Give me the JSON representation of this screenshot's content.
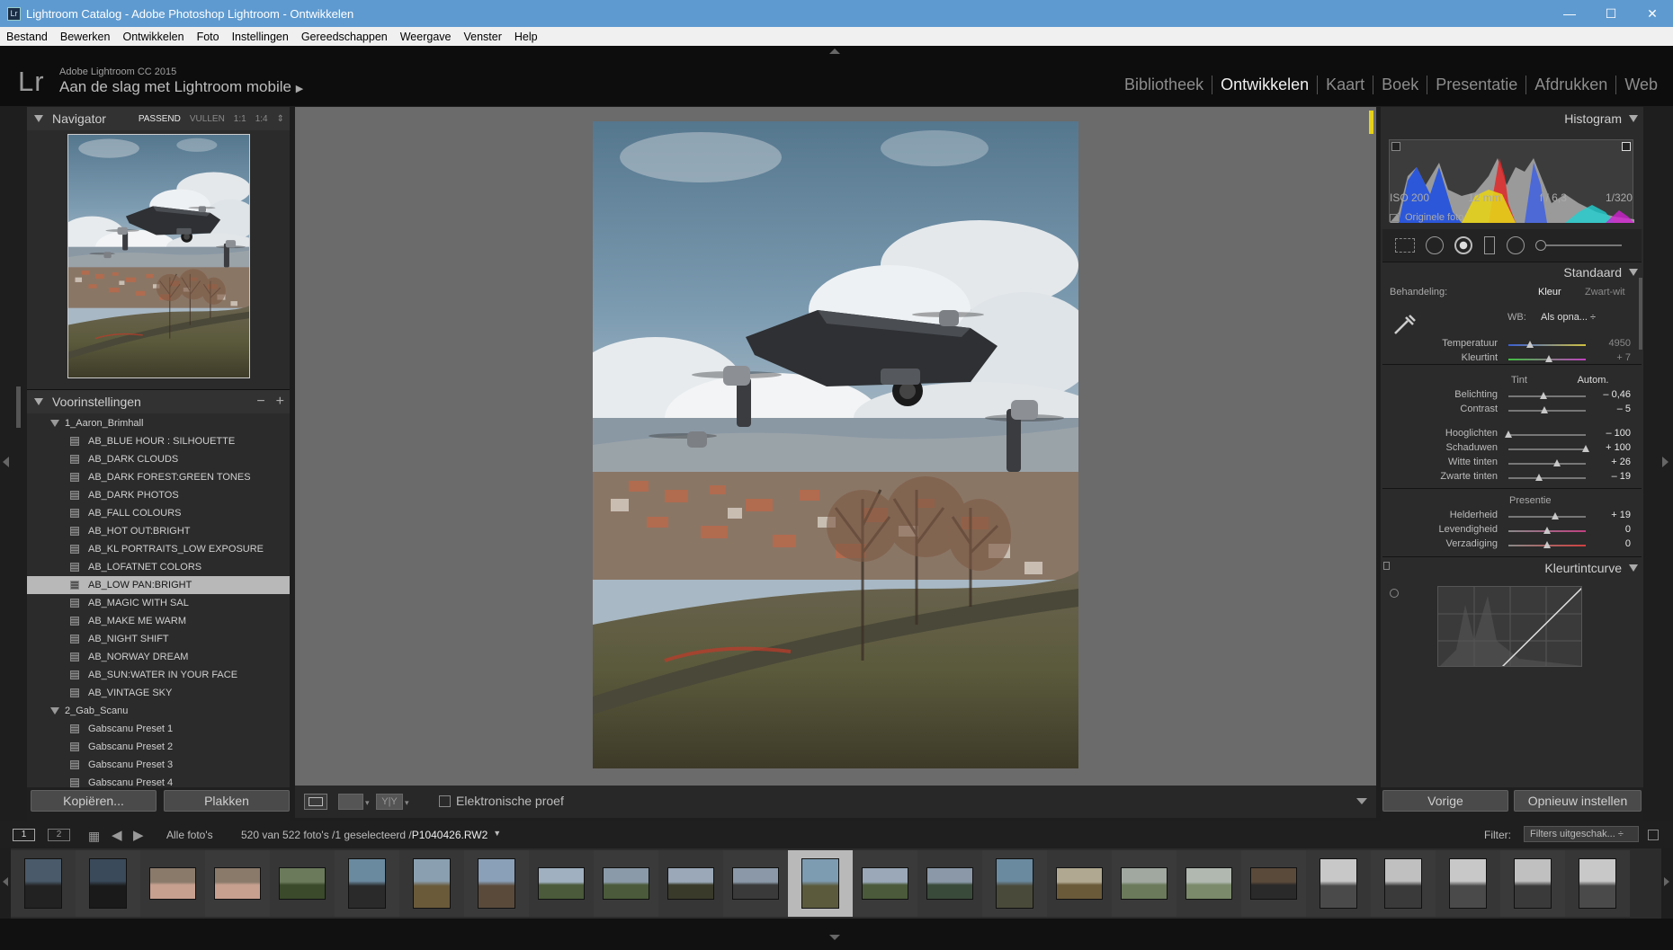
{
  "window": {
    "title": "Lightroom Catalog - Adobe Photoshop Lightroom - Ontwikkelen",
    "controls": {
      "minimize": "—",
      "maximize": "☐",
      "close": "✕"
    }
  },
  "menu": [
    "Bestand",
    "Bewerken",
    "Ontwikkelen",
    "Foto",
    "Instellingen",
    "Gereedschappen",
    "Weergave",
    "Venster",
    "Help"
  ],
  "identity": {
    "logo": "Lr",
    "app": "Adobe Lightroom CC 2015",
    "mobile": "Aan de slag met Lightroom mobile"
  },
  "modules": [
    "Bibliotheek",
    "Ontwikkelen",
    "Kaart",
    "Boek",
    "Presentatie",
    "Afdrukken",
    "Web"
  ],
  "navigator": {
    "title": "Navigator",
    "options": [
      "PASSEND",
      "VULLEN",
      "1:1",
      "1:4"
    ],
    "selected": "PASSEND"
  },
  "presets": {
    "title": "Voorinstellingen",
    "folders": [
      {
        "name": "1_Aaron_Brimhall",
        "items": [
          "AB_BLUE HOUR : SILHOUETTE",
          "AB_DARK CLOUDS",
          "AB_DARK FOREST:GREEN TONES",
          "AB_DARK PHOTOS",
          "AB_FALL COLOURS",
          "AB_HOT OUT:BRIGHT",
          "AB_KL PORTRAITS_LOW EXPOSURE",
          "AB_LOFATNET COLORS",
          "AB_LOW PAN:BRIGHT",
          "AB_MAGIC WITH SAL",
          "AB_MAKE ME WARM",
          "AB_NIGHT SHIFT",
          "AB_NORWAY DREAM",
          "AB_SUN:WATER IN YOUR FACE",
          "AB_VINTAGE SKY"
        ],
        "selected": "AB_LOW PAN:BRIGHT"
      },
      {
        "name": "2_Gab_Scanu",
        "items": [
          "Gabscanu Preset 1",
          "Gabscanu Preset 2",
          "Gabscanu Preset 3",
          "Gabscanu Preset 4"
        ]
      }
    ],
    "copy_button": "Kopiëren...",
    "paste_button": "Plakken"
  },
  "toolbar": {
    "proof_label": "Elektronische proef"
  },
  "histogram": {
    "title": "Histogram",
    "iso": "ISO 200",
    "focal": "12 mm",
    "aperture": "f / 6,3",
    "shutter": "1/320",
    "original_label": "Originele foto"
  },
  "basic": {
    "title": "Standaard",
    "treatment_label": "Behandeling:",
    "treatment_options": [
      "Kleur",
      "Zwart-wit"
    ],
    "wb_label": "WB:",
    "wb_value": "Als opna... ÷",
    "tone_label": "Tint",
    "auto_label": "Autom.",
    "presence_label": "Presentie",
    "sliders": [
      {
        "label": "Temperatuur",
        "value": "4950",
        "pos": 0.28
      },
      {
        "label": "Kleurtint",
        "value": "+ 7",
        "pos": 0.52
      },
      {
        "label": "Belichting",
        "value": "– 0,46",
        "pos": 0.45
      },
      {
        "label": "Contrast",
        "value": "– 5",
        "pos": 0.47
      },
      {
        "label": "Hooglichten",
        "value": "– 100",
        "pos": 0.0
      },
      {
        "label": "Schaduwen",
        "value": "+ 100",
        "pos": 1.0
      },
      {
        "label": "Witte tinten",
        "value": "+ 26",
        "pos": 0.63
      },
      {
        "label": "Zwarte tinten",
        "value": "– 19",
        "pos": 0.4
      },
      {
        "label": "Helderheid",
        "value": "+ 19",
        "pos": 0.6
      },
      {
        "label": "Levendigheid",
        "value": "0",
        "pos": 0.5
      },
      {
        "label": "Verzadiging",
        "value": "0",
        "pos": 0.5
      }
    ]
  },
  "tonecurve": {
    "title": "Kleurtintcurve"
  },
  "right_buttons": {
    "previous": "Vorige",
    "reset": "Opnieuw instellen"
  },
  "filmstrip_bar": {
    "screen1": "1",
    "screen2": "2",
    "source": "Alle foto's",
    "count": "520 van 522 foto's /1 geselecteerd /",
    "filename": "P1040426.RW2",
    "filter_label": "Filter:",
    "filter_value": "Filters uitgeschak... ÷"
  },
  "colors": {
    "accent_yellow": "#e6d21a",
    "selected_row": "#b8b8b8",
    "titlebar": "#5e9ad0"
  }
}
